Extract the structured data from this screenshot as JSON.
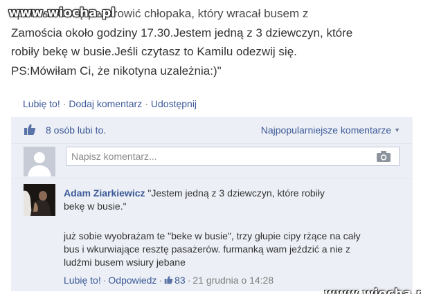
{
  "watermark": {
    "brand": "www.wiocha.pl"
  },
  "post": {
    "lines": [
      "spotted:\"Chcę pozdrowić chłopaka, który wracał busem z",
      "Zamościa około godziny 17.30.Jestem jedną z 3 dziewczyn, które",
      "robiły bekę w busie.Jeśli czytasz to Kamilu odezwij się.",
      "PS:Mówiłam Ci, że nikotyna uzależnia:)\""
    ]
  },
  "actions": {
    "like": "Lubię to!",
    "comment": "Dodaj komentarz",
    "share": "Udostępnij",
    "separator": "·"
  },
  "likes": {
    "icon": "thumbs-up-icon",
    "count_text": "8 osób lubi to.",
    "sort_label": "Najpopularniejsze komentarze"
  },
  "compose": {
    "placeholder": "Napisz komentarz...",
    "camera_icon": "camera-icon"
  },
  "comment": {
    "author": "Adam Ziarkiewicz",
    "quote_part1": "\"Jestem jedną z 3 dziewczyn, które robiły",
    "quote_part2": "bekę w busie.\"",
    "reply_lines": [
      "już sobie wyobrażam te \"beke w busie\", trzy głupie cipy rżące na cały",
      "bus i wkurwiające resztę pasażerów. furmanką wam jeździć a nie z",
      "ludźmi busem wsiury jebane"
    ],
    "meta": {
      "like": "Lubię to!",
      "reply": "Odpowiedz",
      "like_count": "83",
      "timestamp": "21 grudnia o 14:28",
      "separator": "·"
    }
  },
  "colors": {
    "link": "#3b5998",
    "feedback_bg": "#eceff5",
    "muted": "#7f7f7f"
  }
}
